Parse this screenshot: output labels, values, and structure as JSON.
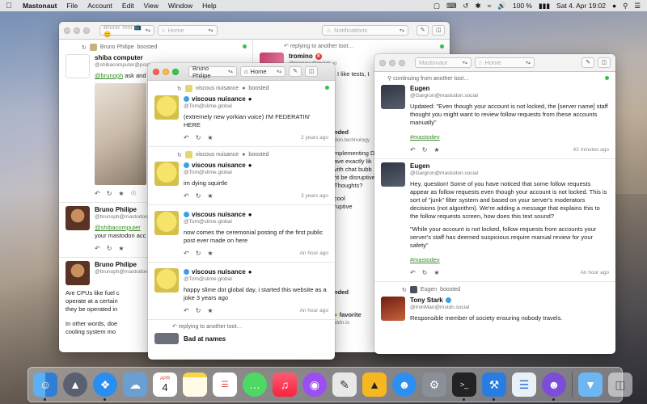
{
  "menubar": {
    "app_name": "Mastonaut",
    "items": [
      "File",
      "Account",
      "Edit",
      "View",
      "Window",
      "Help"
    ],
    "battery": "100 %",
    "datetime": "Sat 4. Apr 19:02"
  },
  "window_back": {
    "account_select": "Bruno Test 📺😊",
    "column1_select": "Home",
    "column2_select": "Notifications",
    "col1": {
      "boost_text": "Bruno Philipe",
      "boosted_label": "boosted",
      "status1": {
        "name": "shiba computer",
        "handle": "@shibacomputer@post",
        "text_prefix": "@brunoph",
        "text": " ask and"
      },
      "status2": {
        "name": "Bruno Philipe",
        "handle": "@brunoph@mastodon.",
        "mention": "@shibacomputer",
        "text": "your mastodon acc"
      },
      "status3": {
        "name": "Bruno Philipe",
        "handle": "@brunoph@mastodon.",
        "text1": "Are CPUs like fuel c",
        "text2": "operate at a certain",
        "text3": "they be operated in",
        "text4": "In other words, doe",
        "text5": "cooling system mo"
      }
    },
    "col2": {
      "reply_label": "replying to another toot…",
      "status1": {
        "name": "tromino",
        "handle": "@tromino@mstdn.io",
        "text": "I like tests, t"
      },
      "frag": [
        "nded",
        "don.technology",
        "mplementing D",
        "ave exactly lik",
        "vith chat bubb",
        "ht be disruptive",
        "Thoughts?",
        "cool",
        "ruptive",
        "nded",
        "favorite",
        "stdn.io"
      ]
    }
  },
  "window_front": {
    "account_select": "Bruno Philipe",
    "column_select": "Home",
    "statuses": [
      {
        "booster": "viscous nuisance",
        "boosted_label": "boosted",
        "name": "viscous nuisance",
        "handle": "@Tom@slime.global",
        "text": "(extremely new yorkian voice) I'M FEDERATIN' HERE",
        "time": "2 years ago"
      },
      {
        "booster": "viscous nuisance",
        "boosted_label": "boosted",
        "name": "viscous nuisance",
        "handle": "@Tom@slime.global",
        "text": "im dying squirtle",
        "time": "3 years ago"
      },
      {
        "name": "viscous nuisance",
        "handle": "@Tom@slime.global",
        "text": "now comes the ceremonial posting of the first public post ever made on here",
        "time": "An hour ago"
      },
      {
        "name": "viscous nuisance",
        "handle": "@Tom@slime.global",
        "text": "happy slime dot global day, i started this website as a joke 3 years ago",
        "time": "An hour ago"
      }
    ],
    "reply_label": "replying to another toot…",
    "last_name": "Bad at names"
  },
  "window_right": {
    "account_select": "Mastonaut",
    "column_select": "Home",
    "continuing_label": "continuing from another toot…",
    "status1": {
      "name": "Eugen",
      "handle": "@Gargron@mastodon.social",
      "text": "Updated: \"Even though your account is not locked, the [server name] staff thought you might want to review follow requests from these accounts manually\"",
      "tag": "#mastodev",
      "time": "42 minutes ago"
    },
    "status2": {
      "name": "Eugen",
      "handle": "@Gargron@mastodon.social",
      "text1": "Hey, question! Some of you have noticed that some follow requests appear as follow requests even though your account is not locked. This is sort of \"junk\" filter system and based on your server's moderators decisions (not algorithm). We're adding a message that explains this to the follow requests screen, how does this text sound?",
      "text2": "\"While your account is not locked, follow requests from accounts your server's staff has deemed suspicious require manual review for your safety\"",
      "tag": "#mastodev",
      "time": "An hour ago"
    },
    "boost_by": "Eugen",
    "boosted_label": "boosted",
    "status3": {
      "name": "Tony Stark",
      "handle": "@IronMan@mstdn.social",
      "text": "Responsible member of society ensuring nobody travels."
    }
  },
  "dock": {
    "calendar_month": "APR",
    "calendar_day": "4"
  },
  "colors": {
    "accent_link": "#3a8a2a",
    "online": "#35c24a",
    "verified": "#3aa0e8"
  }
}
